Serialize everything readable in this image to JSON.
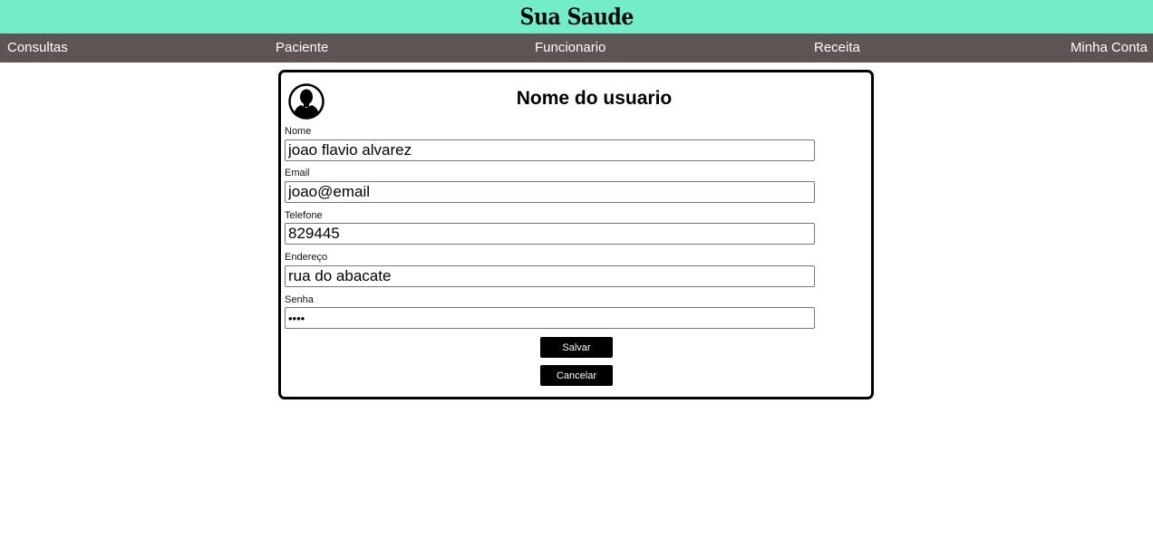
{
  "header": {
    "brand": "Sua Saude"
  },
  "nav": {
    "items": [
      {
        "label": "Consultas"
      },
      {
        "label": "Paciente"
      },
      {
        "label": "Funcionario"
      },
      {
        "label": "Receita"
      },
      {
        "label": "Minha Conta"
      }
    ]
  },
  "card": {
    "title": "Nome do usuario",
    "avatar_icon": "user-silhouette-icon",
    "fields": [
      {
        "label": "Nome",
        "value": "joao flavio alvarez"
      },
      {
        "label": "Email",
        "value": "joao@email"
      },
      {
        "label": "Telefone",
        "value": "829445"
      },
      {
        "label": "Endereço",
        "value": "rua do abacate"
      },
      {
        "label": "Senha",
        "value": "1234"
      }
    ],
    "save_label": "Salvar",
    "cancel_label": "Cancelar"
  },
  "colors": {
    "header_bg": "#72edc8",
    "nav_bg": "#5f5454",
    "button_bg": "#000000"
  }
}
